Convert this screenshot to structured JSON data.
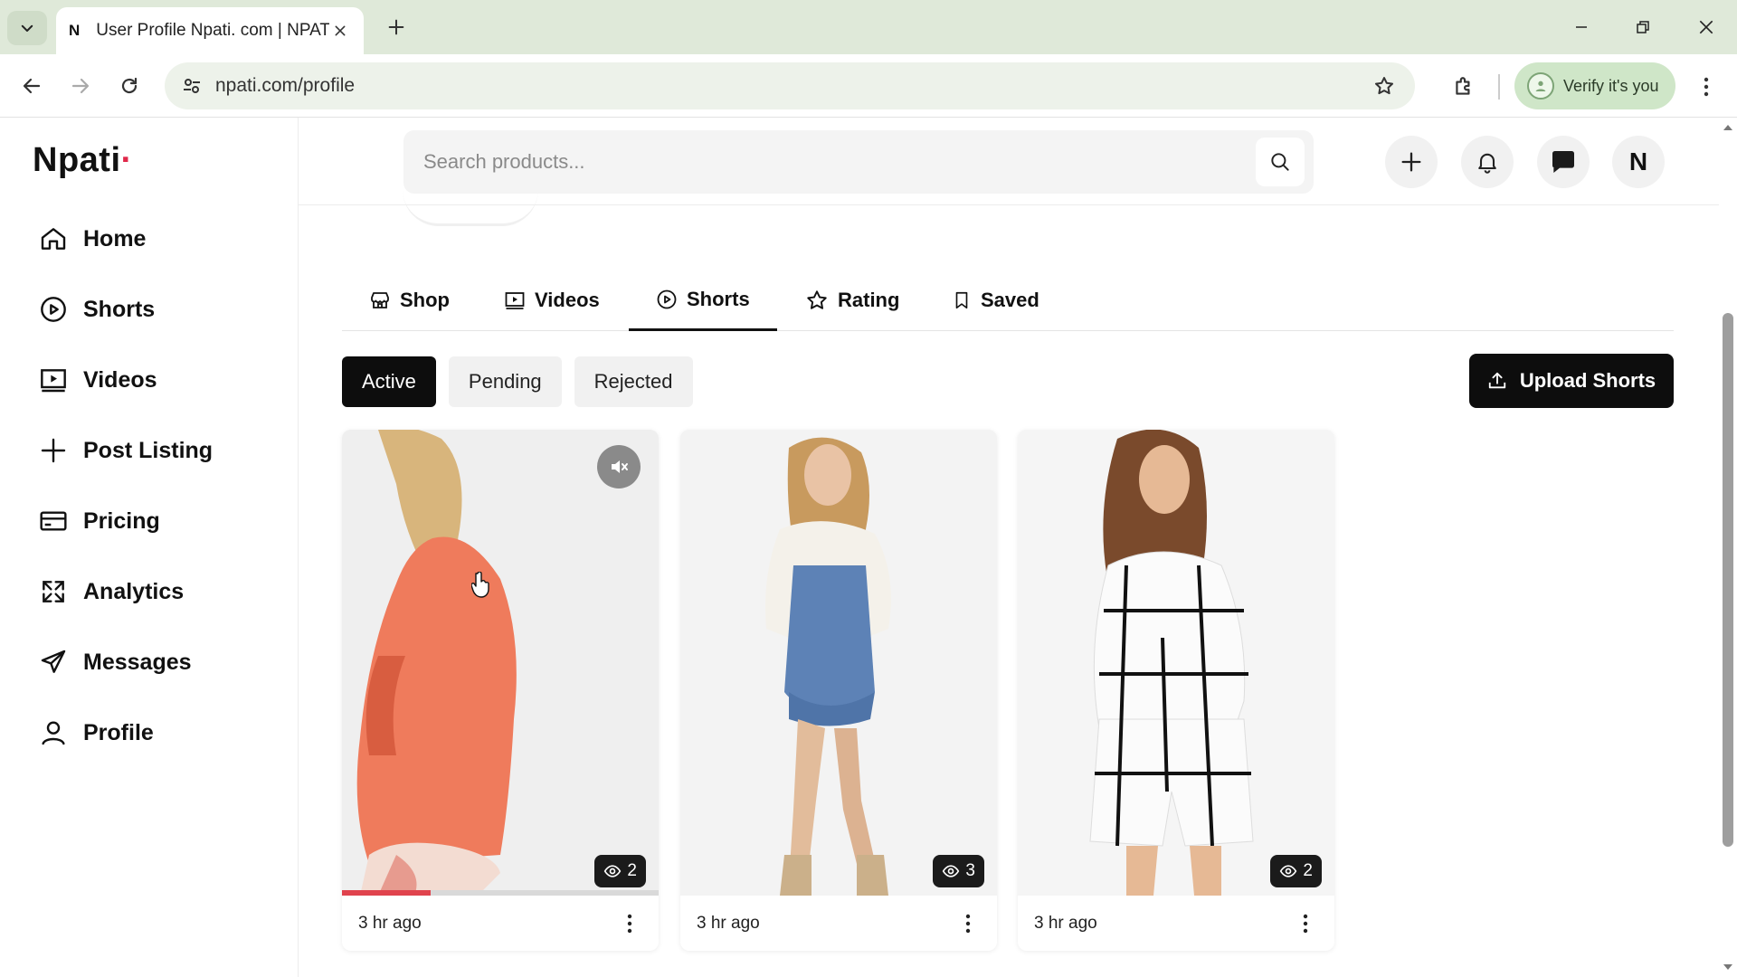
{
  "browser": {
    "tab_title": "User Profile Npati. com | NPATI",
    "tab_favicon": "N",
    "url": "npati.com/profile",
    "verify_label": "Verify it's you"
  },
  "site": {
    "logo": "Npati",
    "logo_dot": "·",
    "accent": "#e0284a"
  },
  "sidebar": {
    "items": [
      {
        "label": "Home",
        "icon": "home-icon"
      },
      {
        "label": "Shorts",
        "icon": "play-circle-icon"
      },
      {
        "label": "Videos",
        "icon": "video-icon"
      },
      {
        "label": "Post Listing",
        "icon": "plus-icon"
      },
      {
        "label": "Pricing",
        "icon": "card-icon"
      },
      {
        "label": "Analytics",
        "icon": "analytics-icon"
      },
      {
        "label": "Messages",
        "icon": "send-icon"
      },
      {
        "label": "Profile",
        "icon": "user-icon"
      }
    ]
  },
  "header": {
    "search_placeholder": "Search products...",
    "avatar_initial": "N"
  },
  "profile_tabs": {
    "items": [
      {
        "label": "Shop",
        "icon": "store-icon"
      },
      {
        "label": "Videos",
        "icon": "video-icon"
      },
      {
        "label": "Shorts",
        "icon": "play-circle-icon",
        "active": true
      },
      {
        "label": "Rating",
        "icon": "star-icon"
      },
      {
        "label": "Saved",
        "icon": "bookmark-icon"
      }
    ]
  },
  "filters": {
    "items": [
      "Active",
      "Pending",
      "Rejected"
    ],
    "selected": "Active"
  },
  "upload_label": "Upload Shorts",
  "shorts": [
    {
      "views": "2",
      "time": "3 hr ago",
      "muted": true,
      "progress": 0.28
    },
    {
      "views": "3",
      "time": "3 hr ago"
    },
    {
      "views": "2",
      "time": "3 hr ago"
    }
  ]
}
